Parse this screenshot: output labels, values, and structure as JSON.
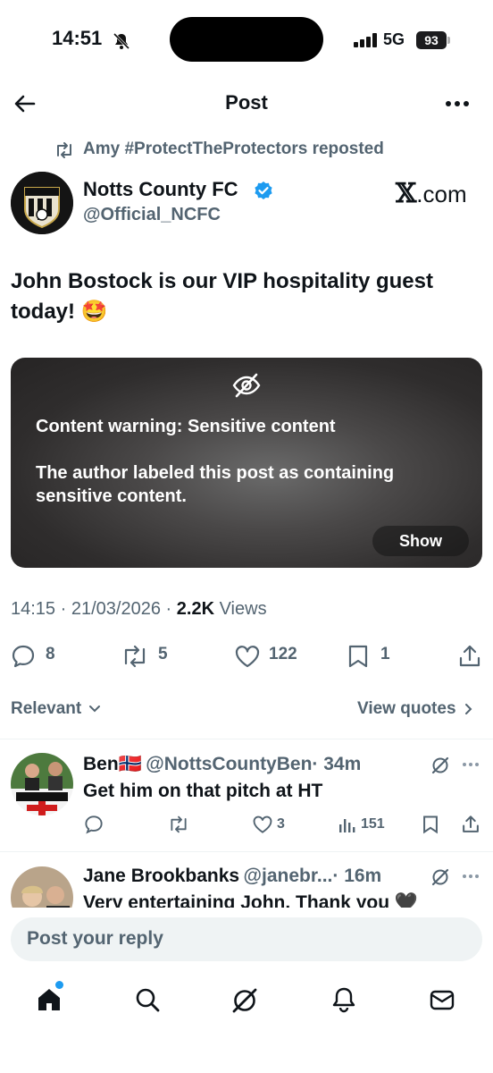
{
  "status_bar": {
    "time": "14:51",
    "network": "5G",
    "battery": "93"
  },
  "header": {
    "title": "Post"
  },
  "repost": {
    "text": "Amy #ProtectTheProtectors reposted"
  },
  "author": {
    "name": "Notts County FC",
    "handle": "@Official_NCFC",
    "badge_text": "Notts County FC"
  },
  "brand": {
    "prefix": "𝕏",
    "suffix": ".com"
  },
  "post": {
    "text": "John Bostock is our VIP hospitality guest today! 🤩",
    "content_warning_title": "Content warning: Sensitive content",
    "content_warning_body": "The author labeled this post as containing sensitive content.",
    "show_label": "Show",
    "time": "14:15",
    "date": "21/03/2026",
    "views_count": "2.2K",
    "views_label": "Views",
    "sep": "·"
  },
  "actions": {
    "replies": "8",
    "reposts": "5",
    "likes": "122",
    "bookmarks": "1"
  },
  "sort": {
    "label": "Relevant",
    "view_quotes": "View quotes"
  },
  "replies": [
    {
      "name": "Ben🇳🇴",
      "handle": "@NottsCountyBen",
      "time": "· 34m",
      "text": "Get him on that pitch at HT",
      "likes": "3",
      "views": "151",
      "avatar_text": "Notts County FC"
    },
    {
      "name": "Jane Brookbanks",
      "handle": "@janebr...",
      "time": "· 16m",
      "text": "Very entertaining John. Thank you 🖤"
    }
  ],
  "reply_input": {
    "placeholder": "Post your reply"
  },
  "colors": {
    "accent": "#1d9bf0",
    "text": "#0f1419",
    "secondary": "#536471"
  }
}
